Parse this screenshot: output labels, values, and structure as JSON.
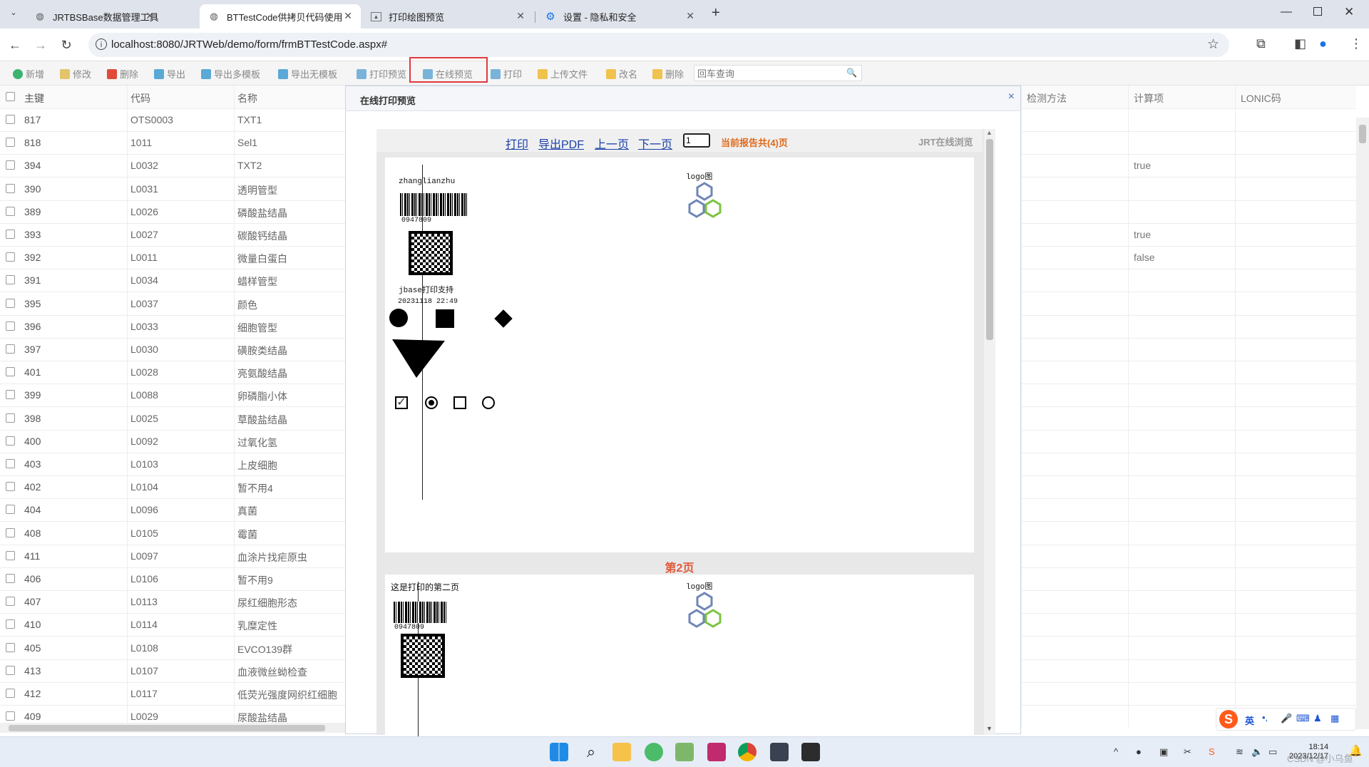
{
  "browser": {
    "tabs": [
      {
        "title": "JRTBSBase数据管理工具",
        "icon": "page-icon"
      },
      {
        "title": "BTTestCode供拷贝代码使用",
        "icon": "page-icon"
      },
      {
        "title": "打印绘图预览",
        "icon": "image-icon"
      },
      {
        "title": "设置 - 隐私和安全",
        "icon": "gear-icon"
      }
    ],
    "new_tab": "+",
    "url": "localhost:8080/JRTWeb/demo/form/frmBTTestCode.aspx#"
  },
  "toolbar": {
    "buttons": [
      "新增",
      "修改",
      "删除",
      "导出",
      "导出多模板",
      "导出无模板",
      "打印预览",
      "在线预览",
      "打印",
      "上传文件",
      "改名",
      "删除"
    ],
    "search_placeholder": "回车查询"
  },
  "grid": {
    "headers": [
      "主键",
      "代码",
      "名称"
    ],
    "rows": [
      [
        "817",
        "OTS0003",
        "TXT1"
      ],
      [
        "818",
        "1011",
        "Sel1"
      ],
      [
        "394",
        "L0032",
        "TXT2"
      ],
      [
        "390",
        "L0031",
        "透明管型"
      ],
      [
        "389",
        "L0026",
        "磷酸盐结晶"
      ],
      [
        "393",
        "L0027",
        "碳酸钙结晶"
      ],
      [
        "392",
        "L0011",
        "微量白蛋白"
      ],
      [
        "391",
        "L0034",
        "蜡样管型"
      ],
      [
        "395",
        "L0037",
        "颜色"
      ],
      [
        "396",
        "L0033",
        "细胞管型"
      ],
      [
        "397",
        "L0030",
        "磺胺类结晶"
      ],
      [
        "401",
        "L0028",
        "亮氨酸结晶"
      ],
      [
        "399",
        "L0088",
        "卵磷脂小体"
      ],
      [
        "398",
        "L0025",
        "草酸盐结晶"
      ],
      [
        "400",
        "L0092",
        "过氧化氢"
      ],
      [
        "403",
        "L0103",
        "上皮细胞"
      ],
      [
        "402",
        "L0104",
        "暂不用4"
      ],
      [
        "404",
        "L0096",
        "真菌"
      ],
      [
        "408",
        "L0105",
        "霉菌"
      ],
      [
        "411",
        "L0097",
        "血涂片找疟原虫"
      ],
      [
        "406",
        "L0106",
        "暂不用9"
      ],
      [
        "407",
        "L0113",
        "尿红细胞形态"
      ],
      [
        "410",
        "L0114",
        "乳糜定性"
      ],
      [
        "405",
        "L0108",
        "EVCO139群"
      ],
      [
        "413",
        "L0107",
        "血液微丝蚴检查"
      ],
      [
        "412",
        "L0117",
        "低荧光强度网织红细胞"
      ],
      [
        "409",
        "L0029",
        "尿酸盐结晶"
      ]
    ],
    "right_headers": [
      "检测方法",
      "计算项",
      "LONIC码"
    ],
    "right_values": {
      "row2": "true",
      "row5": "true",
      "row6": "false"
    }
  },
  "dialog": {
    "title": "在线打印预览",
    "close": "×",
    "viewer": {
      "links": [
        "打印",
        "导出PDF",
        "上一页",
        "下一页"
      ],
      "page_input": "1",
      "page_count": "当前报告共(4)页",
      "brand": "JRT在线浏览",
      "page1": {
        "name": "zhanglianzhu",
        "barcode_num": "0947809",
        "logo_label": "logo图",
        "support": "jbase打印支持",
        "datetime": "20231118 22:49"
      },
      "page2_label": "第2页",
      "page2": {
        "heading": "这是打印的第二页",
        "barcode_num": "0947809",
        "logo_label": "logo图"
      }
    }
  },
  "ime": {
    "lang": "英",
    "punct": "•,"
  },
  "taskbar": {
    "time": "18:14",
    "date": "2023/12/17",
    "watermark": "CSDN @小乌鱼"
  },
  "colors": {
    "highlight": "#e0393e",
    "link": "#1a3fa8",
    "page_count": "#e06a1a",
    "page_label": "#e05a3a",
    "hex_blue": "#6f86b8",
    "hex_green": "#7dc243"
  }
}
